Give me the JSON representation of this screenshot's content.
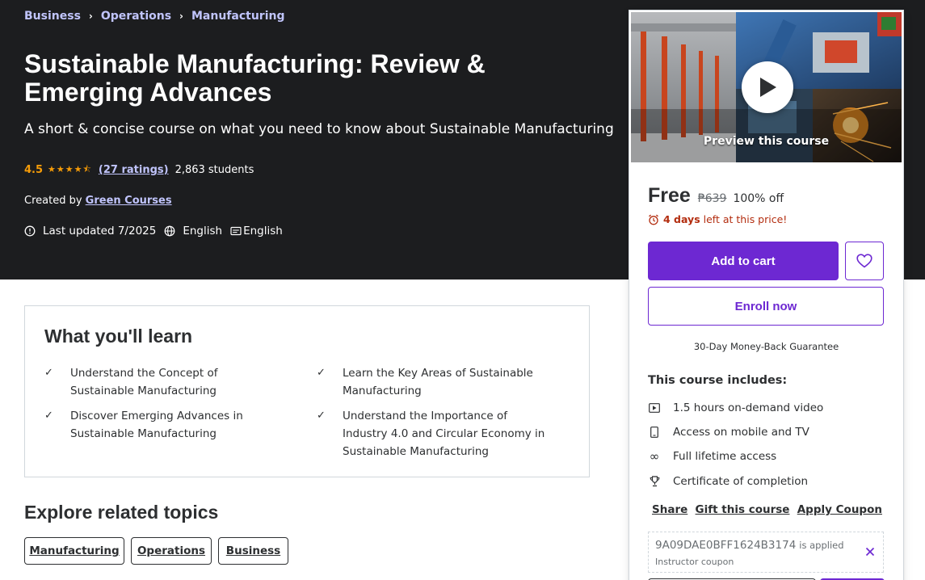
{
  "breadcrumb": [
    "Business",
    "Operations",
    "Manufacturing"
  ],
  "course": {
    "title": "Sustainable Manufacturing: Review & Emerging Advances",
    "subtitle": "A short & concise course on what you need to know about Sustainable Manufacturing",
    "rating": "4.5",
    "stars": "★★★★⯪",
    "ratings_link": "(27 ratings)",
    "students": "2,863 students",
    "created_by_label": "Created by",
    "instructor": "Green Courses",
    "last_updated": "Last updated 7/2025",
    "language": "English",
    "captions": "English"
  },
  "learn": {
    "title": "What you'll learn",
    "items": [
      "Understand the Concept of Sustainable Manufacturing",
      "Learn the Key Areas of Sustainable Manufacturing",
      "Discover Emerging Advances in Sustainable Manufacturing",
      "Understand the Importance of Industry 4.0 and Circular Economy in Sustainable Manufacturing"
    ]
  },
  "explore": {
    "title": "Explore related topics",
    "topics": [
      "Manufacturing",
      "Operations",
      "Business"
    ]
  },
  "sidebar": {
    "preview_label": "Preview this course",
    "price": "Free",
    "old_price": "₱639",
    "discount": "100% off",
    "timer_bold": "4 days",
    "timer_rest": "left at this price!",
    "add_to_cart": "Add to cart",
    "enroll": "Enroll now",
    "guarantee": "30-Day Money-Back Guarantee",
    "includes_title": "This course includes:",
    "includes": [
      {
        "icon": "video-icon",
        "text": "1.5 hours on-demand video"
      },
      {
        "icon": "mobile-icon",
        "text": "Access on mobile and TV"
      },
      {
        "icon": "infinity-icon",
        "text": "Full lifetime access"
      },
      {
        "icon": "trophy-icon",
        "text": "Certificate of completion"
      }
    ],
    "links": [
      "Share",
      "Gift this course",
      "Apply Coupon"
    ],
    "coupon_code": "9A09DAE0BFF1624B3174",
    "coupon_applied": "is applied",
    "coupon_sub": "Instructor coupon"
  },
  "colors": {
    "hero_bg": "#1c1d1f",
    "accent_purple": "#6d28d2",
    "link_lavender": "#c0c4fc",
    "star_orange": "#f69c08",
    "timer_red": "#b32d0f"
  }
}
